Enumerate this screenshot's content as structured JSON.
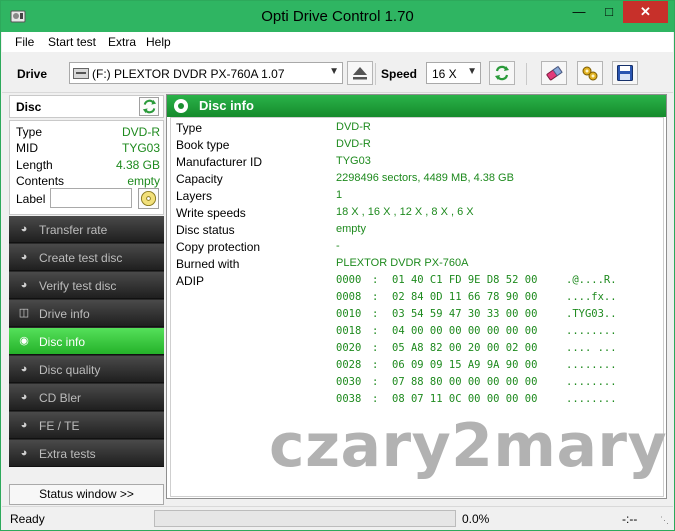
{
  "window": {
    "title": "Opti Drive Control 1.70",
    "min_glyph": "—",
    "max_glyph": "□",
    "close_glyph": "✕"
  },
  "menu": [
    "File",
    "Start test",
    "Extra",
    "Help"
  ],
  "toolbar": {
    "drive_label": "Drive",
    "drive_value": "(F:)   PLEXTOR DVDR   PX-760A 1.07",
    "speed_label": "Speed",
    "speed_value": "16 X"
  },
  "disc_panel": {
    "title": "Disc",
    "rows": [
      {
        "key": "Type",
        "value": "DVD-R"
      },
      {
        "key": "MID",
        "value": "TYG03"
      },
      {
        "key": "Length",
        "value": "4.38 GB"
      },
      {
        "key": "Contents",
        "value": "empty"
      }
    ],
    "label_key": "Label",
    "label_value": ""
  },
  "nav": [
    {
      "label": "Transfer rate",
      "active": false
    },
    {
      "label": "Create test disc",
      "active": false
    },
    {
      "label": "Verify test disc",
      "active": false
    },
    {
      "label": "Drive info",
      "active": false
    },
    {
      "label": "Disc info",
      "active": true
    },
    {
      "label": "Disc quality",
      "active": false
    },
    {
      "label": "CD Bler",
      "active": false
    },
    {
      "label": "FE / TE",
      "active": false
    },
    {
      "label": "Extra tests",
      "active": false
    }
  ],
  "status_window_label": "Status window >>",
  "main": {
    "title": "Disc info",
    "info": [
      {
        "key": "Type",
        "value": "DVD-R"
      },
      {
        "key": "Book type",
        "value": "DVD-R"
      },
      {
        "key": "Manufacturer ID",
        "value": "TYG03"
      },
      {
        "key": "Capacity",
        "value": "2298496 sectors, 4489 MB, 4.38 GB"
      },
      {
        "key": "Layers",
        "value": "1"
      },
      {
        "key": "Write speeds",
        "value": "18 X , 16 X , 12 X , 8 X , 6 X"
      },
      {
        "key": "Disc status",
        "value": "empty"
      },
      {
        "key": "Copy protection",
        "value": "-"
      },
      {
        "key": "Burned with",
        "value": "PLEXTOR  DVDR   PX-760A"
      },
      {
        "key": "ADIP",
        "value": ""
      }
    ],
    "adip": [
      {
        "addr": "0000",
        "bytes": "01 40 C1 FD 9E D8 52 00",
        "ascii": ".@....R."
      },
      {
        "addr": "0008",
        "bytes": "02 84 0D 11 66 78 90 00",
        "ascii": "....fx.."
      },
      {
        "addr": "0010",
        "bytes": "03 54 59 47 30 33 00 00",
        "ascii": ".TYG03.."
      },
      {
        "addr": "0018",
        "bytes": "04 00 00 00 00 00 00 00",
        "ascii": "........"
      },
      {
        "addr": "0020",
        "bytes": "05 A8 82 00 20 00 02 00",
        "ascii": ".... ..."
      },
      {
        "addr": "0028",
        "bytes": "06 09 09 15 A9 9A 90 00",
        "ascii": "........"
      },
      {
        "addr": "0030",
        "bytes": "07 88 80 00 00 00 00 00",
        "ascii": "........"
      },
      {
        "addr": "0038",
        "bytes": "08 07 11 0C 00 00 00 00",
        "ascii": "........"
      }
    ],
    "watermark": "czary2mary"
  },
  "statusbar": {
    "status": "Ready",
    "percent": "0.0%",
    "time": "-:--",
    "progress_fraction": 0
  },
  "colors": {
    "accent_green": "#2fb562",
    "value_green": "#1e8a1e",
    "close_red": "#c7302a"
  }
}
